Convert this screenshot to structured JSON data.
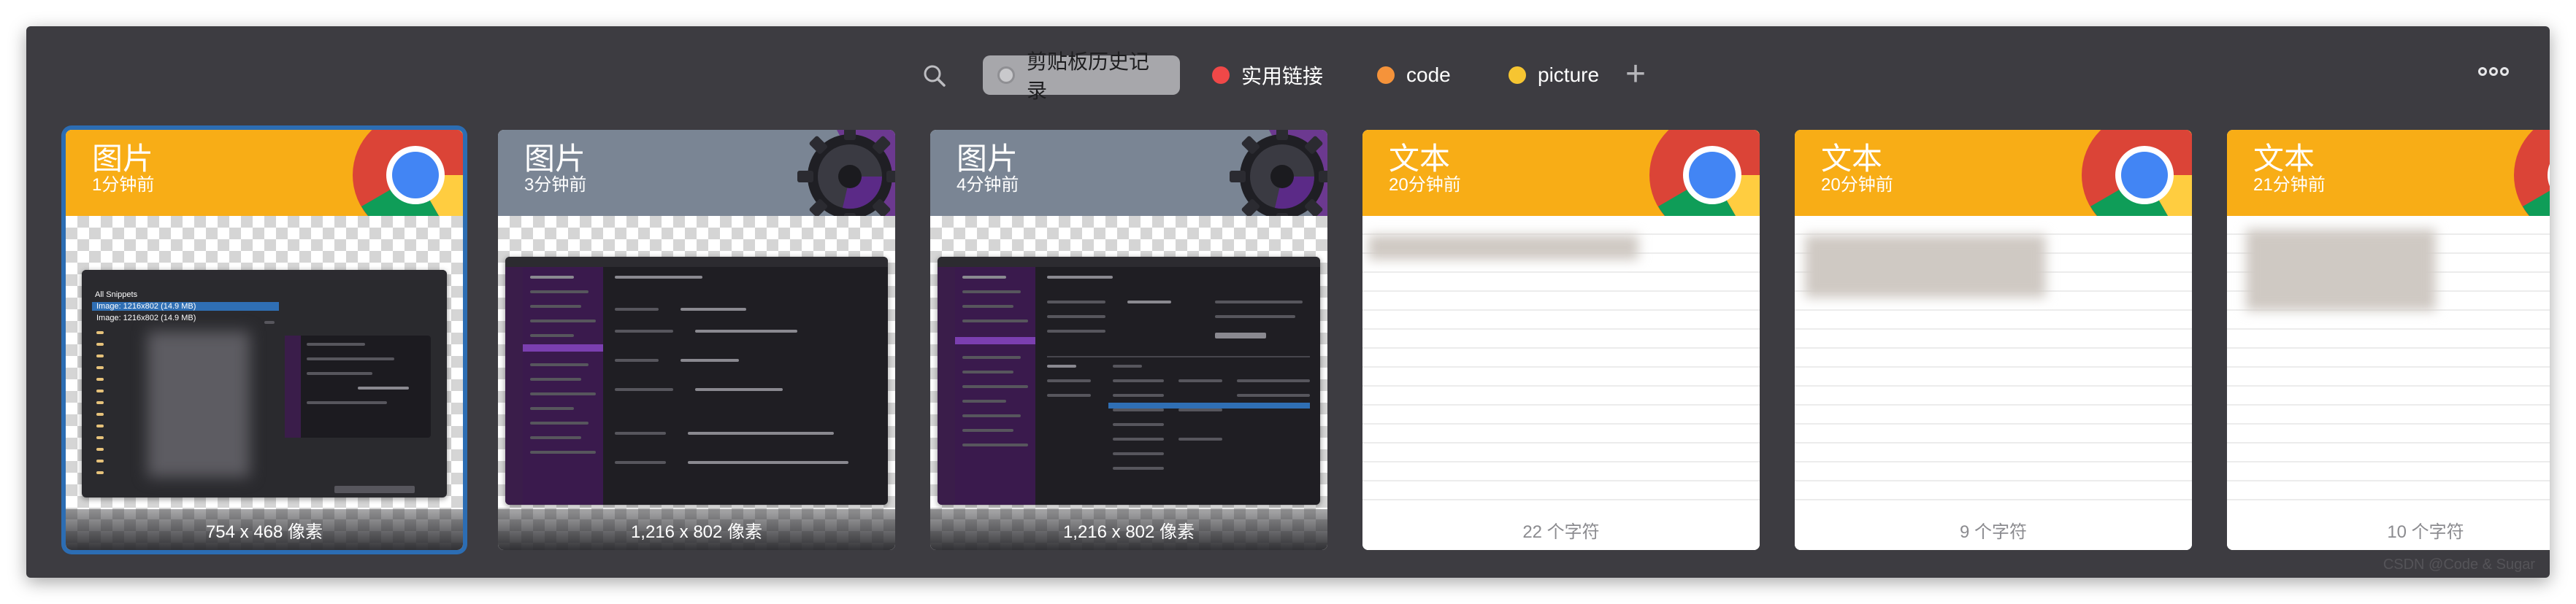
{
  "toolbar": {
    "search_icon": "search-icon",
    "pins": [
      {
        "label": "剪贴板历史记录",
        "color": "#c9c9cc",
        "active": true
      },
      {
        "label": "实用链接",
        "color": "#f04848",
        "active": false
      },
      {
        "label": "code",
        "color": "#f5933a",
        "active": false
      },
      {
        "label": "picture",
        "color": "#f6c531",
        "active": false
      }
    ],
    "add_icon": "plus-icon",
    "more_icon": "more-icon"
  },
  "cards": [
    {
      "type": "图片",
      "time": "1分钟前",
      "footer": "754 x 468 像素",
      "app": "chrome",
      "selected": true
    },
    {
      "type": "图片",
      "time": "3分钟前",
      "footer": "1,216 x 802 像素",
      "app": "gear"
    },
    {
      "type": "图片",
      "time": "4分钟前",
      "footer": "1,216 x 802 像素",
      "app": "gear"
    },
    {
      "type": "文本",
      "time": "20分钟前",
      "footer": "22 个字符",
      "app": "chrome"
    },
    {
      "type": "文本",
      "time": "20分钟前",
      "footer": "9 个字符",
      "app": "chrome"
    },
    {
      "type": "文本",
      "time": "21分钟前",
      "footer": "10 个字符",
      "app": "chrome"
    }
  ],
  "snippets_preview": {
    "all": "All Snippets",
    "rows": [
      "Image: 1216x802 (14.9 MB)",
      "Image: 1216x802 (14.9 MB)"
    ]
  },
  "watermark": "CSDN @Code & Sugar"
}
